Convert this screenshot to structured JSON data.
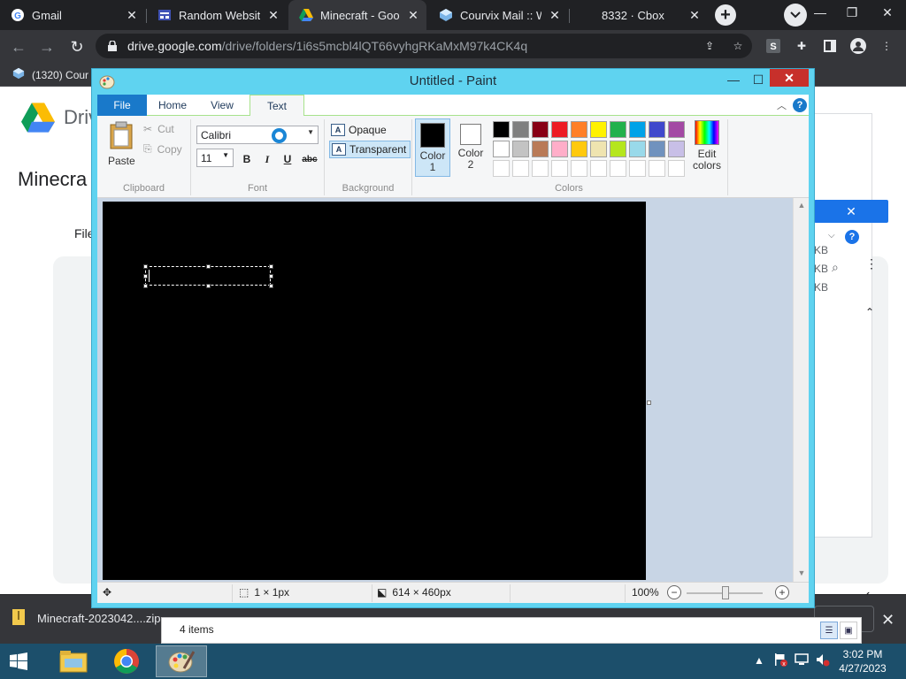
{
  "browser": {
    "tabs": [
      {
        "title": "Gmail",
        "icon": "gmail-icon",
        "active": false
      },
      {
        "title": "Random Website",
        "icon": "random-website-icon",
        "active": false
      },
      {
        "title": "Minecraft - Goog",
        "icon": "google-drive-icon",
        "active": true
      },
      {
        "title": "Courvix Mail :: We",
        "icon": "courvix-icon",
        "active": false
      },
      {
        "title": "8332 · Cbox",
        "icon": "cbox-icon",
        "active": false
      }
    ],
    "url_host": "drive.google.com",
    "url_path": "/drive/folders/1i6s5mcbl4lQT66vyhgRKaMxM97k4CK4q",
    "bookmark": "(1320) Cour"
  },
  "drive": {
    "brand": "Driv",
    "folder_title": "Minecra",
    "files_label": "File",
    "sizes": [
      "KB",
      "KB",
      "KB"
    ]
  },
  "download": {
    "filename": "Minecraft-2023042....zip"
  },
  "explorer": {
    "count": "4 items"
  },
  "paint": {
    "title": "Untitled - Paint",
    "tabs": {
      "file": "File",
      "home": "Home",
      "view": "View",
      "text": "Text"
    },
    "clipboard": {
      "paste": "Paste",
      "cut": "Cut",
      "copy": "Copy",
      "label": "Clipboard"
    },
    "font": {
      "family": "Calibri",
      "size": "11",
      "bold": "B",
      "italic": "I",
      "underline": "U",
      "strike": "abc",
      "label": "Font"
    },
    "background": {
      "opaque": "Opaque",
      "transparent": "Transparent",
      "label": "Background",
      "selected": "transparent"
    },
    "colors": {
      "color1_label": "Color\n1",
      "color1_line1": "Color",
      "color1_line2": "1",
      "color2_line1": "Color",
      "color2_line2": "2",
      "color1": "#000000",
      "color2": "#ffffff",
      "edit_line1": "Edit",
      "edit_line2": "colors",
      "label": "Colors",
      "palette": [
        "#000000",
        "#7f7f7f",
        "#880015",
        "#ed1c24",
        "#ff7f27",
        "#fff200",
        "#22b14c",
        "#00a2e8",
        "#3f48cc",
        "#a349a4",
        "#ffffff",
        "#c3c3c3",
        "#b97a57",
        "#ffaec9",
        "#ffc90e",
        "#efe4b0",
        "#b5e61d",
        "#99d9ea",
        "#7092be",
        "#c8bfe7",
        "#ffffff",
        "#ffffff",
        "#ffffff",
        "#ffffff",
        "#ffffff",
        "#ffffff",
        "#ffffff",
        "#ffffff",
        "#ffffff",
        "#ffffff"
      ]
    },
    "canvas_color": "#000000",
    "status": {
      "selection_size": "1 × 1px",
      "image_size": "614 × 460px",
      "zoom": "100%"
    }
  },
  "taskbar": {
    "time": "3:02 PM",
    "date": "4/27/2023"
  }
}
